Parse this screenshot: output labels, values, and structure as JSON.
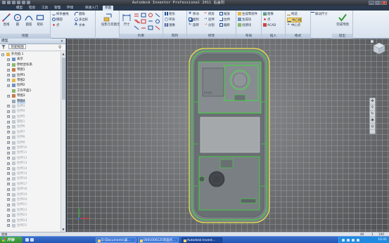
{
  "window": {
    "title": "Autodesk Inventor Professional 2011   后盖附"
  },
  "ribbon_tabs": [
    "",
    "模型",
    "检验",
    "工具",
    "管理",
    "环境",
    "快速入门",
    "草图"
  ],
  "active_tab_index": 7,
  "ribbon": {
    "groups": [
      {
        "caption": "绘图",
        "big": [
          "直线",
          "圆",
          "圆弧",
          "矩形"
        ],
        "small": [
          "样条曲线",
          "椭圆",
          "点",
          "圆角",
          "多边形",
          "文本",
          "投影几何图元"
        ]
      },
      {
        "caption": "约束",
        "big": [
          "尺寸"
        ],
        "small": []
      },
      {
        "caption": "阵列",
        "big": [],
        "small": [
          "矩形",
          "环形",
          "镜像"
        ]
      },
      {
        "caption": "修改",
        "big": [],
        "small": [
          "移动",
          "复制",
          "旋转",
          "修剪",
          "延伸",
          "分割",
          "缩放",
          "拉伸",
          "偏移"
        ]
      },
      {
        "caption": "布局",
        "big": [],
        "small": [
          "生成零部件",
          "生成块",
          "创建块"
        ]
      },
      {
        "caption": "插入",
        "big": [],
        "small": [
          "图像",
          "点",
          "ACAD"
        ]
      },
      {
        "caption": "格式",
        "big": [],
        "small": [
          "构造",
          "中心线",
          "中心点",
          "联动尺寸"
        ]
      },
      {
        "caption": "退出",
        "big": [
          "完成草图"
        ],
        "small": []
      }
    ]
  },
  "browser": {
    "title": "模型",
    "view_label": "装配视图",
    "tree": [
      {
        "label": "外壳组.1",
        "indent": 0,
        "expander": "−",
        "dim": false
      },
      {
        "label": "表示",
        "indent": 1,
        "expander": "+",
        "dim": false
      },
      {
        "label": "原始坐标系",
        "indent": 1,
        "expander": "+",
        "dim": false
      },
      {
        "label": "草图1",
        "indent": 1,
        "expander": "+",
        "dim": false
      },
      {
        "label": "拉伸1",
        "indent": 1,
        "expander": "+",
        "dim": false
      },
      {
        "label": "草图2",
        "indent": 1,
        "expander": "+",
        "dim": false
      },
      {
        "label": "拉伸2",
        "indent": 1,
        "expander": "+",
        "dim": false
      },
      {
        "label": "工作平面1",
        "indent": 1,
        "expander": "",
        "dim": false
      },
      {
        "label": "草图3",
        "indent": 1,
        "expander": "+",
        "dim": false
      },
      {
        "label": "草图4",
        "indent": 1,
        "expander": "",
        "dim": false,
        "selected": true
      },
      {
        "label": "拉伸3",
        "indent": 1,
        "expander": "+",
        "dim": true
      },
      {
        "label": "拉伸4",
        "indent": 1,
        "expander": "+",
        "dim": true
      },
      {
        "label": "拉伸5",
        "indent": 1,
        "expander": "+",
        "dim": true
      },
      {
        "label": "圆角1",
        "indent": 1,
        "expander": "+",
        "dim": true
      },
      {
        "label": "拉伸6",
        "indent": 1,
        "expander": "+",
        "dim": true
      },
      {
        "label": "拉伸7",
        "indent": 1,
        "expander": "+",
        "dim": true
      },
      {
        "label": "拉伸8",
        "indent": 1,
        "expander": "+",
        "dim": true
      },
      {
        "label": "拉伸9",
        "indent": 1,
        "expander": "+",
        "dim": true
      },
      {
        "label": "拉伸10",
        "indent": 1,
        "expander": "+",
        "dim": true
      },
      {
        "label": "拉伸11",
        "indent": 1,
        "expander": "+",
        "dim": true
      },
      {
        "label": "拉伸12",
        "indent": 1,
        "expander": "+",
        "dim": true
      },
      {
        "label": "拉伸13",
        "indent": 1,
        "expander": "+",
        "dim": true
      },
      {
        "label": "拉伸14",
        "indent": 1,
        "expander": "+",
        "dim": true
      },
      {
        "label": "拉伸15",
        "indent": 1,
        "expander": "+",
        "dim": true
      },
      {
        "label": "拉伸16",
        "indent": 1,
        "expander": "+",
        "dim": true
      },
      {
        "label": "拉伸17",
        "indent": 1,
        "expander": "+",
        "dim": true
      },
      {
        "label": "拉伸18",
        "indent": 1,
        "expander": "+",
        "dim": true
      },
      {
        "label": "拉伸19",
        "indent": 1,
        "expander": "+",
        "dim": true
      },
      {
        "label": "拉伸20",
        "indent": 1,
        "expander": "+",
        "dim": true
      },
      {
        "label": "拉伸21",
        "indent": 1,
        "expander": "+",
        "dim": true
      },
      {
        "label": "拉伸22",
        "indent": 1,
        "expander": "+",
        "dim": true
      },
      {
        "label": "拉伸23",
        "indent": 1,
        "expander": "+",
        "dim": true
      },
      {
        "label": "拉伸24",
        "indent": 1,
        "expander": "+",
        "dim": true
      },
      {
        "label": "拉伸25",
        "indent": 1,
        "expander": "+",
        "dim": true
      }
    ]
  },
  "status": {
    "left": "就绪",
    "right_a": "46",
    "right_b": "1",
    "right_c": "100"
  },
  "taskbar": {
    "start_label": "开始",
    "items": [
      {
        "label": "D:\\Documents\\桌...",
        "active": false
      },
      {
        "label": "0001000125背面点...",
        "active": false
      },
      {
        "label": "Autodesk Invent...",
        "active": true
      }
    ],
    "clock": "12:41"
  },
  "colors": {
    "sketch_green": "#39e039",
    "sketch_yellow": "#e8e84a",
    "ribbon_active_tab": "#d7e3f0",
    "taskbar_blue": "#2456b5"
  },
  "icons": {
    "line": "line-icon",
    "circle": "circle-icon",
    "arc": "arc-icon",
    "rectangle": "rectangle-icon",
    "dimension": "dimension-icon",
    "finish": "checkmark-icon",
    "filter": "filter-icon",
    "find": "binoculars-icon"
  }
}
